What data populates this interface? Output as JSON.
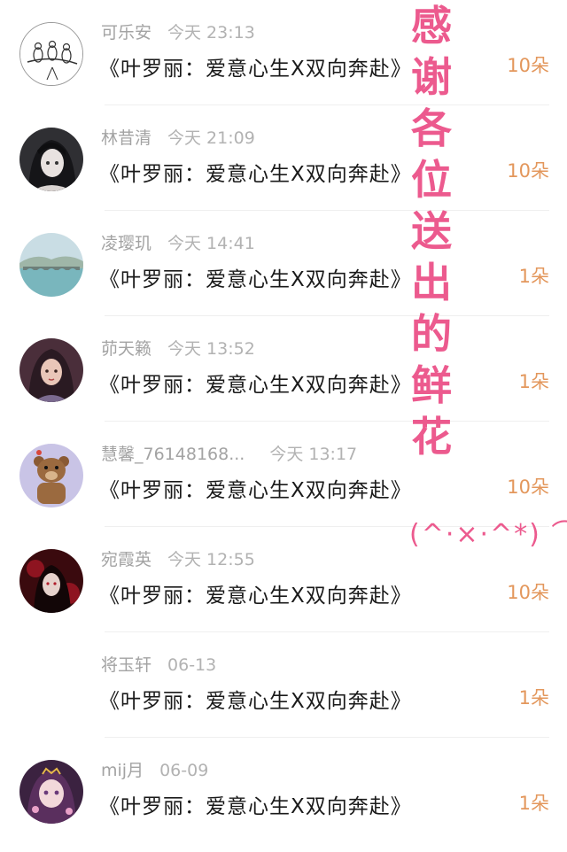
{
  "rows": [
    {
      "name": "可乐安",
      "time": "今天 23:13",
      "title": "《叶罗丽：爱意心生X双向奔赴》",
      "count": "10朵",
      "avatar_icon": "bird-sketch-avatar"
    },
    {
      "name": "林昔清",
      "time": "今天 21:09",
      "title": "《叶罗丽：爱意心生X双向奔赴》",
      "count": "10朵",
      "avatar_icon": "anime-girl-avatar"
    },
    {
      "name": "凌璎玑",
      "time": "今天 14:41",
      "title": "《叶罗丽：爱意心生X双向奔赴》",
      "count": "1朵",
      "avatar_icon": "bridge-landscape-avatar"
    },
    {
      "name": "茆天籁",
      "time": "今天 13:52",
      "title": "《叶罗丽：爱意心生X双向奔赴》",
      "count": "1朵",
      "avatar_icon": "painted-girl-avatar"
    },
    {
      "name": "慧馨_76148168...",
      "time": "今天 13:17",
      "title": "《叶罗丽：爱意心生X双向奔赴》",
      "count": "10朵",
      "avatar_icon": "bear-cartoon-avatar"
    },
    {
      "name": "宛霞英",
      "time": "今天 12:55",
      "title": "《叶罗丽：爱意心生X双向奔赴》",
      "count": "10朵",
      "avatar_icon": "dark-red-anime-avatar"
    },
    {
      "name": "将玉轩",
      "time": "06-13",
      "title": "《叶罗丽：爱意心生X双向奔赴》",
      "count": "1朵",
      "avatar_icon": ""
    },
    {
      "name": "mij月",
      "time": "06-09",
      "title": "《叶罗丽：爱意心生X双向奔赴》",
      "count": "1朵",
      "avatar_icon": "purple-anime-avatar"
    }
  ],
  "overlay": {
    "chars": [
      "感",
      "谢",
      "各",
      "位",
      "送",
      "出",
      "的",
      "鲜",
      "花"
    ],
    "kaomoji": "(^·×·^*) ⌒",
    "color": "#ec5a8e"
  },
  "colors": {
    "count": "#e3975c",
    "name": "#a3a3a3",
    "title": "#1a1a1a"
  }
}
